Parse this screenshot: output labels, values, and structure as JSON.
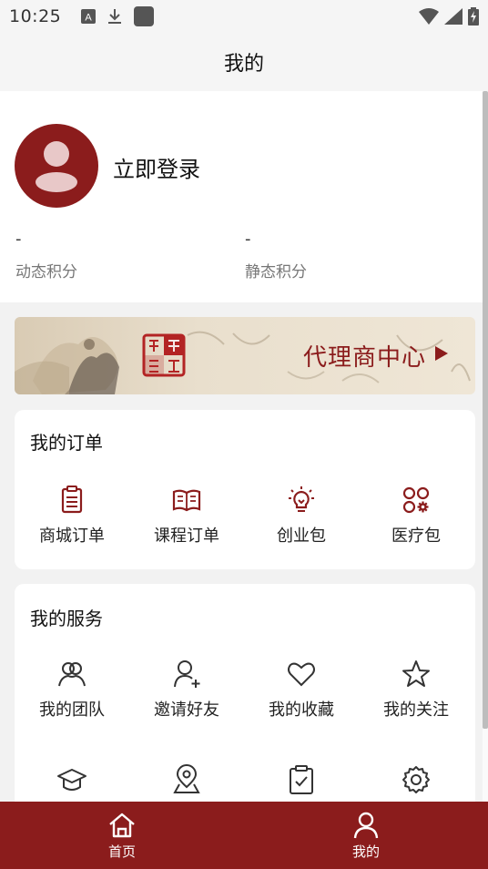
{
  "status_bar": {
    "time": "10:25",
    "left_icons": [
      "notification-a-icon",
      "download-icon",
      "app-square-icon"
    ],
    "right_icons": [
      "wifi-icon",
      "cellular-signal-icon",
      "battery-charging-icon"
    ]
  },
  "header": {
    "title": "我的"
  },
  "profile": {
    "login_text": "立即登录",
    "dynamic_points": {
      "value": "-",
      "label": "动态积分"
    },
    "static_points": {
      "value": "-",
      "label": "静态积分"
    }
  },
  "banner": {
    "text": "代理商中心"
  },
  "orders": {
    "title": "我的订单",
    "items": [
      {
        "label": "商城订单",
        "icon": "clipboard-list-icon"
      },
      {
        "label": "课程订单",
        "icon": "book-open-icon"
      },
      {
        "label": "创业包",
        "icon": "lightbulb-icon"
      },
      {
        "label": "医疗包",
        "icon": "apps-gear-icon"
      }
    ]
  },
  "services": {
    "title": "我的服务",
    "items": [
      {
        "label": "我的团队",
        "icon": "team-icon"
      },
      {
        "label": "邀请好友",
        "icon": "add-user-icon"
      },
      {
        "label": "我的收藏",
        "icon": "heart-icon"
      },
      {
        "label": "我的关注",
        "icon": "star-icon"
      },
      {
        "label": "",
        "icon": "graduation-cap-icon"
      },
      {
        "label": "",
        "icon": "location-pin-icon"
      },
      {
        "label": "",
        "icon": "clipboard-check-icon"
      },
      {
        "label": "",
        "icon": "settings-gear-icon"
      }
    ]
  },
  "tab_bar": {
    "tabs": [
      {
        "label": "首页",
        "icon": "home-icon"
      },
      {
        "label": "我的",
        "icon": "user-icon"
      }
    ]
  },
  "colors": {
    "brand": "#8b1c1c",
    "icon_stroke": "#8b1c1c",
    "service_icon_stroke": "#333333"
  }
}
